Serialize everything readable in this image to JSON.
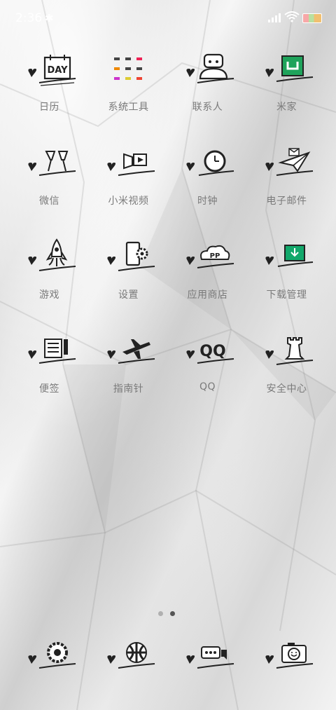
{
  "status_bar": {
    "time": "2:36",
    "bluetooth_icon": "bluetooth-icon",
    "signal_icon": "signal-icon",
    "wifi_icon": "wifi-icon",
    "battery_icon": "battery-icon"
  },
  "apps": [
    {
      "label": "日历",
      "icon": "calendar-icon"
    },
    {
      "label": "系统工具",
      "icon": "system-tools-icon"
    },
    {
      "label": "联系人",
      "icon": "contacts-icon"
    },
    {
      "label": "米家",
      "icon": "mijia-icon"
    },
    {
      "label": "微信",
      "icon": "wechat-icon"
    },
    {
      "label": "小米视频",
      "icon": "video-icon"
    },
    {
      "label": "时钟",
      "icon": "clock-icon"
    },
    {
      "label": "电子邮件",
      "icon": "email-icon"
    },
    {
      "label": "游戏",
      "icon": "games-icon"
    },
    {
      "label": "设置",
      "icon": "settings-icon"
    },
    {
      "label": "应用商店",
      "icon": "app-store-icon"
    },
    {
      "label": "下载管理",
      "icon": "downloads-icon"
    },
    {
      "label": "便签",
      "icon": "notes-icon"
    },
    {
      "label": "指南针",
      "icon": "compass-icon"
    },
    {
      "label": "QQ",
      "icon": "qq-icon"
    },
    {
      "label": "安全中心",
      "icon": "security-icon"
    }
  ],
  "calendar_text": "DAY",
  "qq_text": "QQ",
  "dock": [
    {
      "icon": "phone-icon"
    },
    {
      "icon": "browser-icon"
    },
    {
      "icon": "messages-icon"
    },
    {
      "icon": "camera-icon"
    }
  ],
  "page_indicator": {
    "pages": 2,
    "current": 2
  }
}
